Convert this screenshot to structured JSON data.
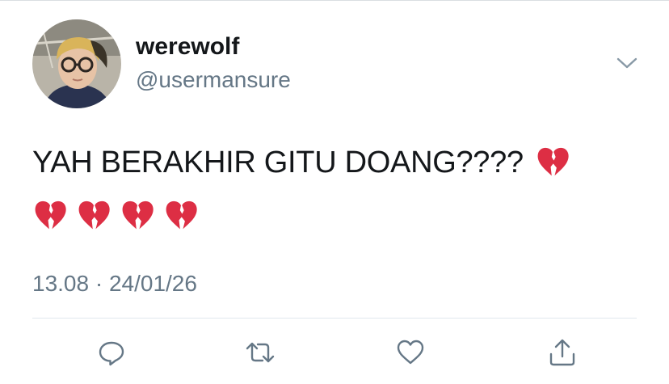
{
  "tweet": {
    "author": {
      "display_name": "werewolf",
      "handle": "@usermansure"
    },
    "text_line_1": "YAH BERAKHIR GITU DOANG????",
    "emoji": "broken-heart",
    "emoji_count_line_1": 1,
    "emoji_count_line_2": 4,
    "timestamp": "13.08 · 24/01/26"
  },
  "actions": [
    {
      "name": "reply",
      "icon": "reply-icon"
    },
    {
      "name": "retweet",
      "icon": "retweet-icon"
    },
    {
      "name": "like",
      "icon": "heart-icon"
    },
    {
      "name": "share",
      "icon": "share-icon"
    }
  ],
  "colors": {
    "text_primary": "#14171a",
    "text_secondary": "#657786",
    "icon_gray": "#657786",
    "divider": "#e1e8ed",
    "heart_red": "#dd2e44"
  }
}
